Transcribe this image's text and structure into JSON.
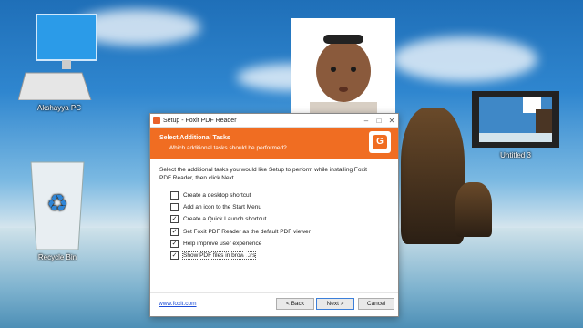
{
  "desktop": {
    "icons": [
      {
        "label": "Akshayya PC"
      },
      {
        "label": "Recycle Bin"
      },
      {
        "label": "Untitled 3"
      }
    ]
  },
  "window": {
    "title": "Setup - Foxit PDF Reader",
    "header": {
      "title": "Select Additional Tasks",
      "subtitle": "Which additional tasks should be performed?",
      "logo_text": "G"
    },
    "intro": "Select the additional tasks you would like Setup to perform while installing Foxit PDF Reader, then click Next.",
    "tasks": [
      {
        "label": "Create a desktop shortcut",
        "checked": false
      },
      {
        "label": "Add an icon to the Start Menu",
        "checked": false
      },
      {
        "label": "Create a Quick Launch shortcut",
        "checked": true
      },
      {
        "label": "Set Foxit PDF Reader as the default PDF viewer",
        "checked": true
      },
      {
        "label": "Help improve user experience",
        "checked": true
      },
      {
        "label": "Show PDF files in browsers",
        "checked": true
      }
    ],
    "footer": {
      "link": "www.foxit.com",
      "back": "< Back",
      "next": "Next >",
      "cancel": "Cancel"
    }
  }
}
